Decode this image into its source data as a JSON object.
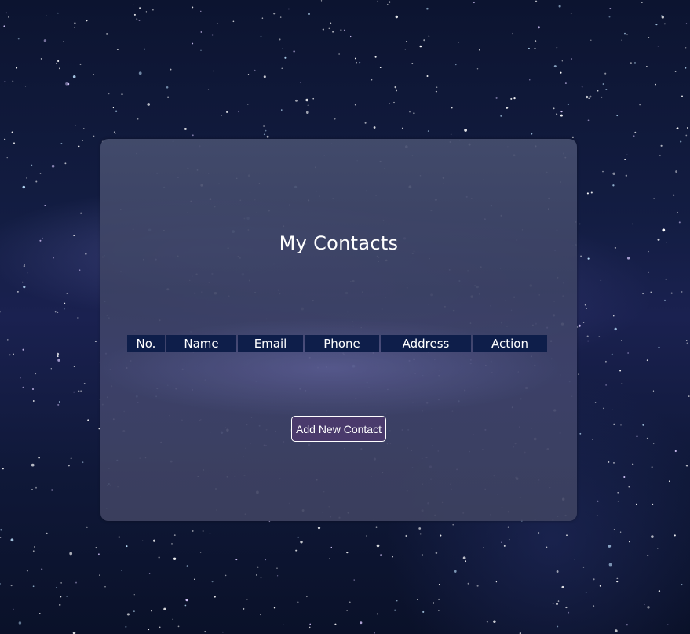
{
  "page": {
    "title": "My Contacts"
  },
  "table": {
    "headers": [
      "No.",
      "Name",
      "Email",
      "Phone",
      "Address",
      "Action"
    ],
    "rows": []
  },
  "actions": {
    "add_label": "Add New Contact"
  },
  "colors": {
    "header_bg": "#0e1e4a",
    "button_bg": "#4a3a6c",
    "text": "#ffffff"
  }
}
